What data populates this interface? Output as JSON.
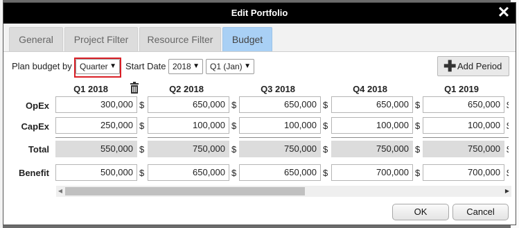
{
  "dialog": {
    "title": "Edit Portfolio"
  },
  "tabs": [
    {
      "label": "General"
    },
    {
      "label": "Project Filter"
    },
    {
      "label": "Resource Filter"
    },
    {
      "label": "Budget"
    }
  ],
  "controls": {
    "plan_label": "Plan budget by",
    "plan_value": "Quarter",
    "start_label": "Start Date",
    "year_value": "2018",
    "quarter_value": "Q1 (Jan)",
    "add_period_label": "Add Period"
  },
  "budget": {
    "periods": [
      "Q1 2018",
      "Q2 2018",
      "Q3 2018",
      "Q4 2018",
      "Q1 2019"
    ],
    "currency": "$",
    "rows": {
      "opex_label": "OpEx",
      "capex_label": "CapEx",
      "total_label": "Total",
      "benefit_label": "Benefit"
    },
    "opex": [
      "300,000",
      "650,000",
      "650,000",
      "650,000",
      "650,000"
    ],
    "capex": [
      "250,000",
      "100,000",
      "100,000",
      "100,000",
      "100,000"
    ],
    "total": [
      "550,000",
      "750,000",
      "750,000",
      "750,000",
      "750,000"
    ],
    "benefit": [
      "500,000",
      "650,000",
      "650,000",
      "700,000",
      "700,000"
    ]
  },
  "footer": {
    "ok_label": "OK",
    "cancel_label": "Cancel"
  },
  "colors": {
    "active_tab": "#a9d0f5",
    "highlight": "#d91f26",
    "titlebar": "#000000"
  }
}
